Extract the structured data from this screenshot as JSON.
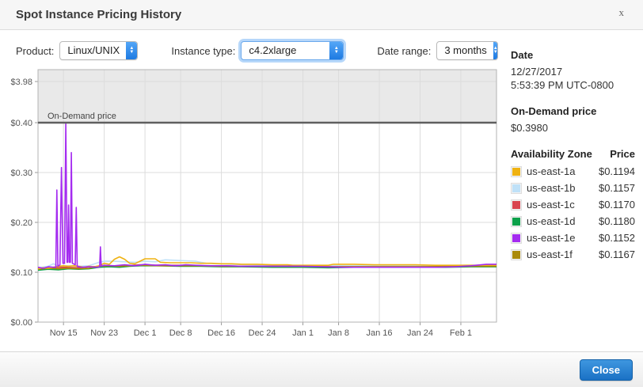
{
  "dialog": {
    "title": "Spot Instance Pricing History",
    "close_icon": "x"
  },
  "controls": {
    "product": {
      "label": "Product:",
      "value": "Linux/UNIX"
    },
    "instance_type": {
      "label": "Instance type:",
      "value": "c4.2xlarge"
    },
    "date_range": {
      "label": "Date range:",
      "value": "3 months"
    }
  },
  "info_panel": {
    "date_heading": "Date",
    "date_value": "12/27/2017",
    "time_value": "5:53:39 PM UTC-0800",
    "on_demand_heading": "On-Demand price",
    "on_demand_value": "$0.3980",
    "table": {
      "col_zone": "Availability Zone",
      "col_price": "Price",
      "rows": [
        {
          "zone": "us-east-1a",
          "price": "$0.1194",
          "color": "#efb211"
        },
        {
          "zone": "us-east-1b",
          "price": "$0.1157",
          "color": "#bfe1f8"
        },
        {
          "zone": "us-east-1c",
          "price": "$0.1170",
          "color": "#d9444f"
        },
        {
          "zone": "us-east-1d",
          "price": "$0.1180",
          "color": "#0ca14a"
        },
        {
          "zone": "us-east-1e",
          "price": "$0.1152",
          "color": "#a42bf0"
        },
        {
          "zone": "us-east-1f",
          "price": "$0.1167",
          "color": "#aa8a0a"
        }
      ]
    }
  },
  "footer": {
    "close_label": "Close"
  },
  "chart_data": {
    "type": "line",
    "title": "",
    "xlabel": "",
    "ylabel": "",
    "grid": true,
    "legend_position": "right-panel",
    "y_axis": {
      "linear_max": 0.4,
      "top_value": 3.98,
      "compressed_above_linear_max": true,
      "ticks": [
        {
          "label": "$3.98",
          "value": 3.98
        },
        {
          "label": "$0.40",
          "value": 0.4
        },
        {
          "label": "$0.30",
          "value": 0.3
        },
        {
          "label": "$0.20",
          "value": 0.2
        },
        {
          "label": "$0.10",
          "value": 0.1
        },
        {
          "label": "$0.00",
          "value": 0.0
        }
      ]
    },
    "x_axis": {
      "domain_days": [
        0,
        90
      ],
      "ticks": [
        {
          "label": "Nov 15",
          "day": 5
        },
        {
          "label": "Nov 23",
          "day": 13
        },
        {
          "label": "Dec 1",
          "day": 21
        },
        {
          "label": "Dec 8",
          "day": 28
        },
        {
          "label": "Dec 16",
          "day": 36
        },
        {
          "label": "Dec 24",
          "day": 44
        },
        {
          "label": "Jan 1",
          "day": 52
        },
        {
          "label": "Jan 8",
          "day": 59
        },
        {
          "label": "Jan 16",
          "day": 67
        },
        {
          "label": "Jan 24",
          "day": 75
        },
        {
          "label": "Feb 1",
          "day": 83
        }
      ]
    },
    "on_demand": {
      "label": "On-Demand price",
      "value": 0.398,
      "line_value": 0.4,
      "band_color": "#e9e9e9",
      "line_color": "#5f5f5f"
    },
    "series": [
      {
        "name": "us-east-1b",
        "color": "#bfe1f8",
        "points": [
          [
            0,
            0.109
          ],
          [
            2,
            0.112
          ],
          [
            3,
            0.117
          ],
          [
            4,
            0.112
          ],
          [
            6,
            0.113
          ],
          [
            8,
            0.112
          ],
          [
            10,
            0.113
          ],
          [
            12,
            0.12
          ],
          [
            13,
            0.122
          ],
          [
            15,
            0.122
          ],
          [
            17,
            0.121
          ],
          [
            19,
            0.12
          ],
          [
            21,
            0.122
          ],
          [
            23,
            0.121
          ],
          [
            25,
            0.125
          ],
          [
            27,
            0.124
          ],
          [
            29,
            0.123
          ],
          [
            31,
            0.122
          ],
          [
            33,
            0.118
          ],
          [
            35,
            0.117
          ],
          [
            38,
            0.116
          ],
          [
            42,
            0.115
          ],
          [
            46,
            0.114
          ],
          [
            50,
            0.114
          ],
          [
            55,
            0.113
          ],
          [
            60,
            0.113
          ],
          [
            66,
            0.113
          ],
          [
            72,
            0.113
          ],
          [
            78,
            0.113
          ],
          [
            84,
            0.114
          ],
          [
            90,
            0.114
          ]
        ]
      },
      {
        "name": "us-east-1c",
        "color": "#d9444f",
        "points": [
          [
            0,
            0.108
          ],
          [
            3,
            0.109
          ],
          [
            5,
            0.11
          ],
          [
            8,
            0.109
          ],
          [
            12,
            0.112
          ],
          [
            16,
            0.112
          ],
          [
            20,
            0.115
          ],
          [
            24,
            0.114
          ],
          [
            28,
            0.114
          ],
          [
            32,
            0.113
          ],
          [
            36,
            0.113
          ],
          [
            40,
            0.112
          ],
          [
            46,
            0.112
          ],
          [
            52,
            0.112
          ],
          [
            58,
            0.111
          ],
          [
            64,
            0.111
          ],
          [
            70,
            0.111
          ],
          [
            76,
            0.111
          ],
          [
            82,
            0.111
          ],
          [
            86,
            0.112
          ],
          [
            90,
            0.112
          ]
        ]
      },
      {
        "name": "us-east-1d",
        "color": "#0ca14a",
        "points": [
          [
            0,
            0.104
          ],
          [
            2,
            0.106
          ],
          [
            4,
            0.105
          ],
          [
            6,
            0.107
          ],
          [
            8,
            0.106
          ],
          [
            10,
            0.107
          ],
          [
            12,
            0.11
          ],
          [
            14,
            0.111
          ],
          [
            16,
            0.11
          ],
          [
            18,
            0.112
          ],
          [
            20,
            0.113
          ],
          [
            24,
            0.113
          ],
          [
            28,
            0.112
          ],
          [
            32,
            0.112
          ],
          [
            36,
            0.111
          ],
          [
            40,
            0.111
          ],
          [
            46,
            0.11
          ],
          [
            52,
            0.11
          ],
          [
            57,
            0.109
          ],
          [
            62,
            0.11
          ],
          [
            68,
            0.11
          ],
          [
            74,
            0.11
          ],
          [
            80,
            0.11
          ],
          [
            85,
            0.111
          ],
          [
            90,
            0.111
          ]
        ]
      },
      {
        "name": "us-east-1f",
        "color": "#aa8a0a",
        "points": [
          [
            0,
            0.106
          ],
          [
            2,
            0.108
          ],
          [
            4,
            0.107
          ],
          [
            6,
            0.108
          ],
          [
            8,
            0.107
          ],
          [
            10,
            0.108
          ],
          [
            12,
            0.112
          ],
          [
            14,
            0.113
          ],
          [
            16,
            0.112
          ],
          [
            18,
            0.113
          ],
          [
            20,
            0.114
          ],
          [
            24,
            0.113
          ],
          [
            28,
            0.113
          ],
          [
            32,
            0.113
          ],
          [
            36,
            0.112
          ],
          [
            40,
            0.112
          ],
          [
            46,
            0.112
          ],
          [
            52,
            0.112
          ],
          [
            58,
            0.111
          ],
          [
            64,
            0.111
          ],
          [
            70,
            0.111
          ],
          [
            76,
            0.111
          ],
          [
            82,
            0.112
          ],
          [
            90,
            0.112
          ]
        ]
      },
      {
        "name": "us-east-1a",
        "color": "#efb211",
        "points": [
          [
            0,
            0.107
          ],
          [
            1,
            0.109
          ],
          [
            2,
            0.108
          ],
          [
            3,
            0.11
          ],
          [
            4,
            0.112
          ],
          [
            5,
            0.113
          ],
          [
            6,
            0.112
          ],
          [
            7,
            0.113
          ],
          [
            8,
            0.112
          ],
          [
            9,
            0.11
          ],
          [
            10,
            0.112
          ],
          [
            11,
            0.111
          ],
          [
            12,
            0.113
          ],
          [
            13,
            0.118
          ],
          [
            14,
            0.116
          ],
          [
            15,
            0.126
          ],
          [
            16,
            0.131
          ],
          [
            17,
            0.126
          ],
          [
            18,
            0.118
          ],
          [
            19,
            0.117
          ],
          [
            20,
            0.122
          ],
          [
            21,
            0.127
          ],
          [
            23,
            0.127
          ],
          [
            24,
            0.12
          ],
          [
            26,
            0.119
          ],
          [
            28,
            0.119
          ],
          [
            30,
            0.119
          ],
          [
            32,
            0.118
          ],
          [
            34,
            0.118
          ],
          [
            36,
            0.117
          ],
          [
            38,
            0.117
          ],
          [
            40,
            0.116
          ],
          [
            43,
            0.116
          ],
          [
            46,
            0.115
          ],
          [
            49,
            0.115
          ],
          [
            50,
            0.114
          ],
          [
            53,
            0.114
          ],
          [
            57,
            0.114
          ],
          [
            58,
            0.116
          ],
          [
            62,
            0.116
          ],
          [
            66,
            0.115
          ],
          [
            70,
            0.115
          ],
          [
            74,
            0.115
          ],
          [
            78,
            0.114
          ],
          [
            82,
            0.114
          ],
          [
            86,
            0.114
          ],
          [
            90,
            0.114
          ]
        ]
      },
      {
        "name": "us-east-1e",
        "color": "#a42bf0",
        "points": [
          [
            0,
            0.11
          ],
          [
            1,
            0.108
          ],
          [
            2,
            0.111
          ],
          [
            3,
            0.11
          ],
          [
            3.5,
            0.11
          ],
          [
            3.7,
            0.265
          ],
          [
            3.9,
            0.112
          ],
          [
            4.3,
            0.115
          ],
          [
            4.6,
            0.31
          ],
          [
            4.9,
            0.118
          ],
          [
            5.2,
            0.118
          ],
          [
            5.45,
            0.398
          ],
          [
            5.7,
            0.12
          ],
          [
            5.85,
            0.12
          ],
          [
            6.0,
            0.235
          ],
          [
            6.15,
            0.12
          ],
          [
            6.35,
            0.12
          ],
          [
            6.55,
            0.34
          ],
          [
            6.75,
            0.118
          ],
          [
            7.3,
            0.115
          ],
          [
            7.5,
            0.23
          ],
          [
            7.7,
            0.112
          ],
          [
            8.5,
            0.11
          ],
          [
            10,
            0.111
          ],
          [
            11.5,
            0.11
          ],
          [
            12.1,
            0.111
          ],
          [
            12.25,
            0.151
          ],
          [
            12.4,
            0.112
          ],
          [
            13,
            0.114
          ],
          [
            15,
            0.113
          ],
          [
            17,
            0.115
          ],
          [
            19,
            0.113
          ],
          [
            21,
            0.116
          ],
          [
            23,
            0.114
          ],
          [
            25,
            0.115
          ],
          [
            27,
            0.113
          ],
          [
            29,
            0.115
          ],
          [
            31,
            0.114
          ],
          [
            34,
            0.113
          ],
          [
            37,
            0.113
          ],
          [
            40,
            0.112
          ],
          [
            44,
            0.112
          ],
          [
            48,
            0.112
          ],
          [
            52,
            0.112
          ],
          [
            56,
            0.111
          ],
          [
            60,
            0.11
          ],
          [
            66,
            0.11
          ],
          [
            72,
            0.11
          ],
          [
            78,
            0.11
          ],
          [
            82,
            0.111
          ],
          [
            85,
            0.113
          ],
          [
            88,
            0.116
          ],
          [
            90,
            0.116
          ]
        ]
      }
    ]
  }
}
